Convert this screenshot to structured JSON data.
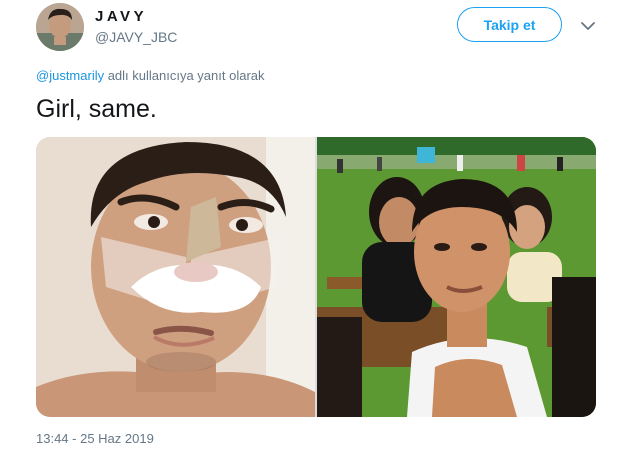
{
  "user": {
    "display_name": "JAVY",
    "handle": "@JAVY_JBC"
  },
  "follow_button": {
    "label": "Takip et"
  },
  "reply_context": {
    "mention": "@justmarily",
    "text": " adlı kullanıcıya yanıt olarak"
  },
  "tweet": {
    "text": "Girl, same.",
    "timestamp": "13:44 - 25 Haz 2019"
  },
  "colors": {
    "accent": "#1da1f2",
    "mention": "#1b95e0",
    "secondary_text": "#657786"
  },
  "icons": {
    "caret": "chevron-down-icon"
  }
}
